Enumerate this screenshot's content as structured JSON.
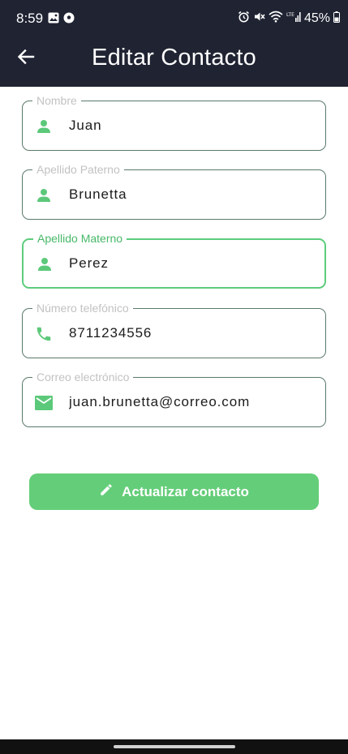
{
  "status_bar": {
    "time": "8:59",
    "battery_text": "45%",
    "icons_left": [
      "image-icon",
      "soccer-ball-icon"
    ],
    "icons_right": [
      "alarm-icon",
      "mute-icon",
      "wifi-icon",
      "lte-signal-icon",
      "battery-icon"
    ]
  },
  "app_bar": {
    "title": "Editar Contacto",
    "back_icon": "arrow-back-icon"
  },
  "form": {
    "fields": [
      {
        "label": "Nombre",
        "value": "Juan",
        "icon": "person-icon",
        "focused": false
      },
      {
        "label": "Apellido Paterno",
        "value": "Brunetta",
        "icon": "person-icon",
        "focused": false
      },
      {
        "label": "Apellido Materno",
        "value": "Perez",
        "icon": "person-icon",
        "focused": true
      },
      {
        "label": "Número telefónico",
        "value": "8711234556",
        "icon": "phone-icon",
        "focused": false
      },
      {
        "label": "Correo electrónico",
        "value": "juan.brunetta@correo.com",
        "icon": "email-icon",
        "focused": false
      }
    ],
    "submit_label": "Actualizar contacto",
    "submit_icon": "pencil-icon"
  },
  "colors": {
    "app_bar": "#1f2332",
    "accent": "#64cd79",
    "icon_green": "#5cc97a",
    "focused_label": "#47b868",
    "unfocused_label": "#c2c2c2",
    "field_border": "#5a7a6a"
  }
}
